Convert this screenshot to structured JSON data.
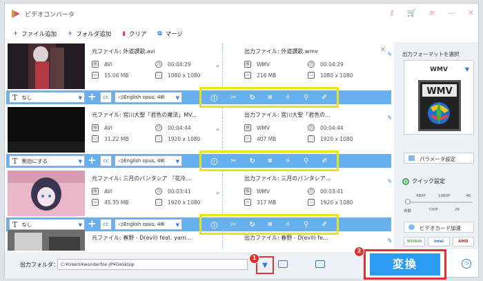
{
  "app": {
    "title": "ビデオコンバータ"
  },
  "titlebar": {
    "icons": [
      "key-icon",
      "cart-icon",
      "menu-icon",
      "minimize-icon",
      "close-icon"
    ]
  },
  "toolbar": {
    "add_file": "ファイル追加",
    "add_folder": "フォルダ追加",
    "clear": "クリア",
    "merge": "マージ"
  },
  "items": [
    {
      "src_name": "元ファイル: 外道讃歌.avi",
      "src_format": "AVI",
      "src_duration": "00:04:29",
      "src_size": "15.06 MB",
      "src_res": "1080 x 1080",
      "out_name": "出力ファイル: 外道讃歌.wmv",
      "out_format": "WMV",
      "out_duration": "00:04:29",
      "out_size": "216 MB",
      "out_res": "1080 x 1080",
      "subtitle": "なし",
      "audio": "English opus, 48l"
    },
    {
      "src_name": "元ファイル: 宮川大聖「君色の魔法」MV...",
      "src_format": "AVI",
      "src_duration": "00:04:44",
      "src_size": "31.22 MB",
      "src_res": "1920 x 1080",
      "out_name": "出力ファイル: 宮川大聖「君色の...",
      "out_format": "WMV",
      "out_duration": "00:04:44",
      "out_size": "407 MB",
      "out_res": "1920 x 1080",
      "subtitle": "無効にする",
      "audio": "English opus, 48l"
    },
    {
      "src_name": "元ファイル: 三月のパンタシア 『花冷...",
      "src_format": "AVI",
      "src_duration": "00:03:41",
      "src_size": "45.35 MB",
      "src_res": "1920 x 1080",
      "out_name": "出力ファイル: 三月のパンタシア...",
      "out_format": "WMV",
      "out_duration": "00:03:41",
      "out_size": "317 MB",
      "out_res": "1920 x 1080",
      "subtitle": "なし",
      "audio": "English opus, 48l"
    },
    {
      "src_name": "元ファイル: 春野 - D(evil) feat. yam...",
      "out_name": "出力ファイル: 春野 - D(evil) fe..."
    }
  ],
  "right_panel": {
    "title": "出力フォーマットを選択",
    "format": "WMV",
    "format_img_label": "WMV",
    "param_label": "パラメータ設定",
    "quick_label": "クイック設定",
    "quick_top": [
      "480P",
      "1080P",
      "4K"
    ],
    "quick_bottom": [
      "自動",
      "720P",
      "2K"
    ],
    "gpu_label": "ビデオカード加速",
    "gpu_vendors": [
      "NVIDIA",
      "intel",
      "AMD"
    ]
  },
  "bottom": {
    "output_label": "出力フォルダ：",
    "output_path": "C:¥Users¥wonderfox-JP¥Desktop",
    "badge1": "1",
    "badge2": "2",
    "convert": "変換"
  }
}
